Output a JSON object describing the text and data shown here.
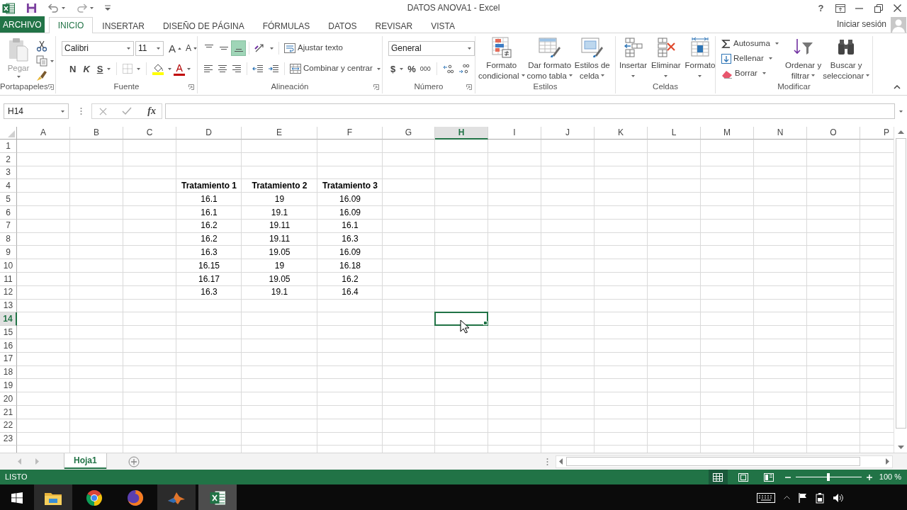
{
  "window": {
    "title": "DATOS ANOVA1 - Excel",
    "help": "?"
  },
  "tabs": [
    {
      "label": "ARCHIVO",
      "kind": "backstage",
      "selected": false
    },
    {
      "label": "INICIO",
      "kind": "tab",
      "selected": true
    },
    {
      "label": "INSERTAR",
      "kind": "tab",
      "selected": false
    },
    {
      "label": "DISEÑO DE PÁGINA",
      "kind": "tab",
      "selected": false
    },
    {
      "label": "FÓRMULAS",
      "kind": "tab",
      "selected": false
    },
    {
      "label": "DATOS",
      "kind": "tab",
      "selected": false
    },
    {
      "label": "REVISAR",
      "kind": "tab",
      "selected": false
    },
    {
      "label": "VISTA",
      "kind": "tab",
      "selected": false
    }
  ],
  "account": {
    "label": "Iniciar sesión"
  },
  "ribbon": {
    "clipboard": {
      "label": "Portapapeles",
      "paste": {
        "label": "Pegar",
        "disabled": true
      }
    },
    "font": {
      "label": "Fuente",
      "font_name": "Calibri",
      "font_size": "11",
      "grow": "A",
      "shrink": "A",
      "bold": "N",
      "italic": "K",
      "underline": "S",
      "font_color": "A"
    },
    "alignment": {
      "label": "Alineación",
      "vertical": [
        {
          "selected": false
        },
        {
          "selected": false
        },
        {
          "selected": true
        }
      ],
      "wrap_text": "Ajustar texto",
      "merge": "Combinar y centrar"
    },
    "number": {
      "label": "Número",
      "format": "General",
      "currency": "$",
      "percent": "%",
      "thousands": "000"
    },
    "styles": {
      "label": "Estilos",
      "buttons": [
        {
          "kind": "conditional",
          "lines": [
            "Formato",
            "condicional"
          ]
        },
        {
          "kind": "table",
          "lines": [
            "Dar formato",
            "como tabla"
          ]
        },
        {
          "kind": "cell",
          "lines": [
            "Estilos de",
            "celda"
          ]
        }
      ]
    },
    "cells": {
      "label": "Celdas",
      "buttons": [
        {
          "kind": "insert",
          "label": "Insertar"
        },
        {
          "kind": "delete",
          "label": "Eliminar"
        },
        {
          "kind": "format",
          "label": "Formato"
        }
      ]
    },
    "editing": {
      "label": "Modificar",
      "small": [
        {
          "kind": "sum",
          "label": "Autosuma"
        },
        {
          "kind": "fill",
          "label": "Rellenar"
        },
        {
          "kind": "clear",
          "label": "Borrar"
        }
      ],
      "buttons": [
        {
          "kind": "sort",
          "lines": [
            "Ordenar y",
            "filtrar"
          ]
        },
        {
          "kind": "find",
          "lines": [
            "Buscar y",
            "seleccionar"
          ]
        }
      ]
    }
  },
  "formula_bar": {
    "name_box": "H14",
    "function_button": "fx"
  },
  "sheet": {
    "columns": [
      {
        "label": "A",
        "selected": false
      },
      {
        "label": "B",
        "selected": false
      },
      {
        "label": "C",
        "selected": false
      },
      {
        "label": "D",
        "selected": false
      },
      {
        "label": "E",
        "selected": false
      },
      {
        "label": "F",
        "selected": false
      },
      {
        "label": "G",
        "selected": false
      },
      {
        "label": "H",
        "selected": true
      },
      {
        "label": "I",
        "selected": false
      },
      {
        "label": "J",
        "selected": false
      },
      {
        "label": "K",
        "selected": false
      },
      {
        "label": "L",
        "selected": false
      },
      {
        "label": "M",
        "selected": false
      },
      {
        "label": "N",
        "selected": false
      },
      {
        "label": "O",
        "selected": false
      },
      {
        "label": "P",
        "selected": false
      }
    ],
    "rows": [
      {
        "label": "1",
        "selected": false
      },
      {
        "label": "2",
        "selected": false
      },
      {
        "label": "3",
        "selected": false
      },
      {
        "label": "4",
        "selected": false
      },
      {
        "label": "5",
        "selected": false
      },
      {
        "label": "6",
        "selected": false
      },
      {
        "label": "7",
        "selected": false
      },
      {
        "label": "8",
        "selected": false
      },
      {
        "label": "9",
        "selected": false
      },
      {
        "label": "10",
        "selected": false
      },
      {
        "label": "11",
        "selected": false
      },
      {
        "label": "12",
        "selected": false
      },
      {
        "label": "13",
        "selected": false
      },
      {
        "label": "14",
        "selected": true
      },
      {
        "label": "15",
        "selected": false
      },
      {
        "label": "16",
        "selected": false
      },
      {
        "label": "17",
        "selected": false
      },
      {
        "label": "18",
        "selected": false
      },
      {
        "label": "19",
        "selected": false
      },
      {
        "label": "20",
        "selected": false
      },
      {
        "label": "21",
        "selected": false
      },
      {
        "label": "22",
        "selected": false
      },
      {
        "label": "23",
        "selected": false
      }
    ],
    "table": {
      "header": [
        "Tratamiento 1",
        "Tratamiento 2",
        "Tratamiento 3"
      ],
      "rows": [
        [
          "16.1",
          "19",
          "16.09"
        ],
        [
          "16.1",
          "19.1",
          "16.09"
        ],
        [
          "16.2",
          "19.11",
          "16.1"
        ],
        [
          "16.2",
          "19.11",
          "16.3"
        ],
        [
          "16.3",
          "19.05",
          "16.09"
        ],
        [
          "16.15",
          "19",
          "16.18"
        ],
        [
          "16.17",
          "19.05",
          "16.2"
        ],
        [
          "16.3",
          "19.1",
          "16.4"
        ]
      ]
    }
  },
  "sheet_tabs": [
    {
      "label": "Hoja1",
      "selected": true
    }
  ],
  "status_bar": {
    "status": "LISTO",
    "views": [
      {
        "kind": "normal",
        "selected": true
      },
      {
        "kind": "page_layout",
        "selected": false
      },
      {
        "kind": "page_break",
        "selected": false
      }
    ],
    "zoom": {
      "level": 0.5,
      "label": "100 %"
    }
  },
  "taskbar": {
    "apps": [
      {
        "kind": "explorer",
        "running": true,
        "selected": false
      },
      {
        "kind": "chrome",
        "running": false,
        "selected": false
      },
      {
        "kind": "firefox",
        "running": false,
        "selected": false
      },
      {
        "kind": "matlab",
        "running": true,
        "selected": false
      },
      {
        "kind": "excel",
        "running": true,
        "selected": true
      }
    ]
  }
}
